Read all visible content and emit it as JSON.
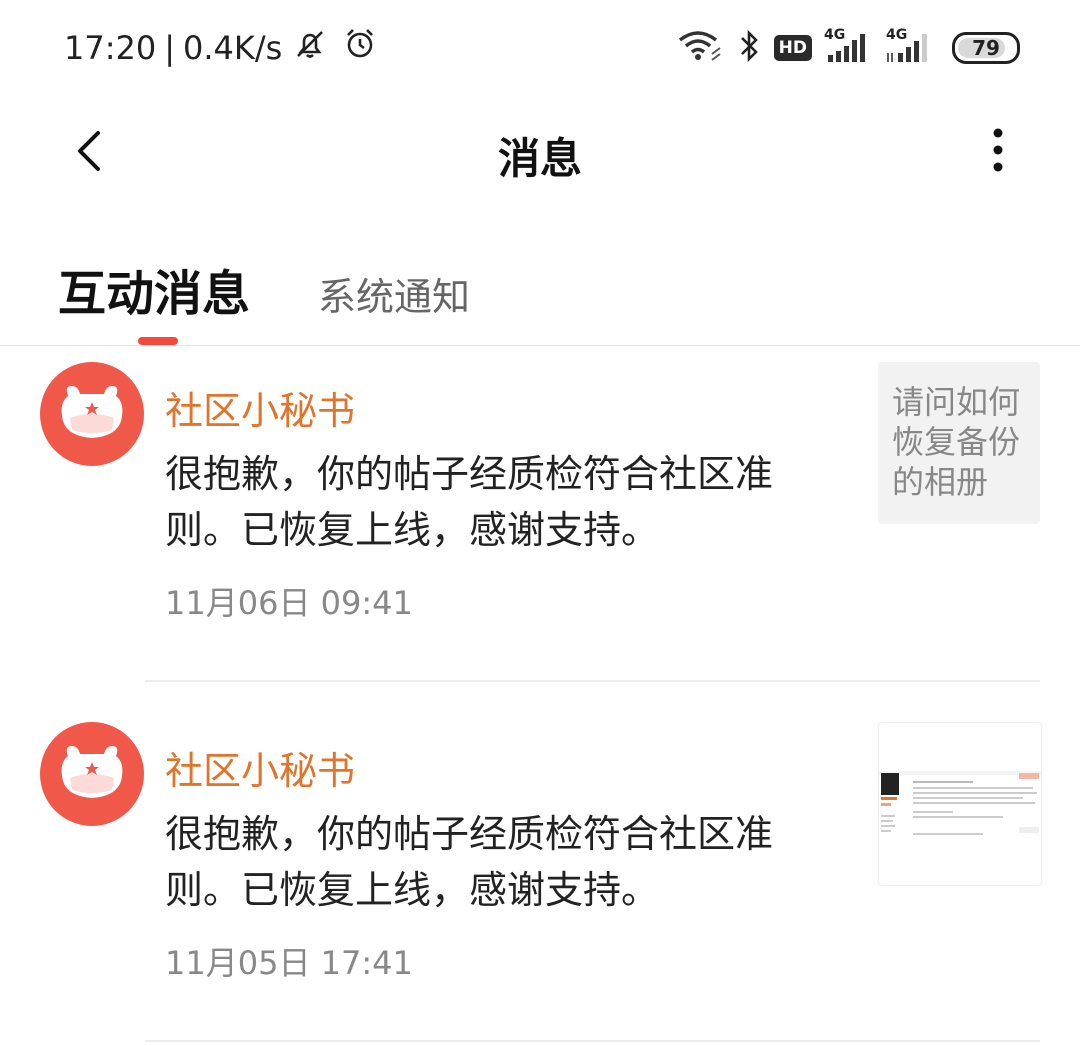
{
  "status_bar": {
    "time": "17:20",
    "separator": "|",
    "net_speed": "0.4K/s",
    "hd": "HD",
    "sim1_net": "4G",
    "sim2_net": "4G",
    "battery": "79"
  },
  "header": {
    "title": "消息"
  },
  "tabs": [
    {
      "label": "互动消息",
      "active": true
    },
    {
      "label": "系统通知",
      "active": false
    }
  ],
  "messages": [
    {
      "sender": "社区小秘书",
      "content": "很抱歉，你的帖子经质检符合社区准则。已恢复上线，感谢支持。",
      "time": "11月06日 09:41",
      "thumbnail_text": "请问如何恢复备份的相册"
    },
    {
      "sender": "社区小秘书",
      "content": "很抱歉，你的帖子经质检符合社区准则。已恢复上线，感谢支持。",
      "time": "11月05日 17:41"
    }
  ],
  "colors": {
    "accent": "#f24a3c",
    "sender": "#e0742a",
    "avatar": "#f0584a"
  }
}
